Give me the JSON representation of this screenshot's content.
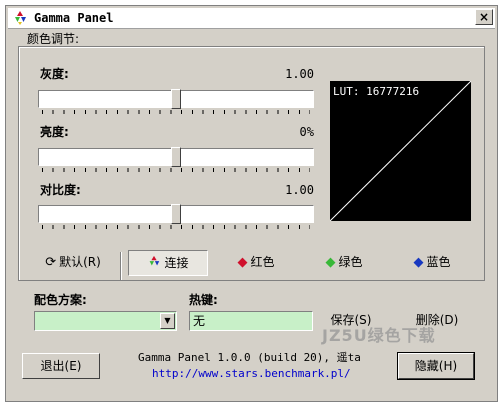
{
  "window": {
    "title": "Gamma Panel",
    "close_label": "×"
  },
  "color_adjust": {
    "group_label": "颜色调节:",
    "sliders": [
      {
        "label": "灰度:",
        "value": "1.00",
        "position": 0.5
      },
      {
        "label": "亮度:",
        "value": "0%",
        "position": 0.5
      },
      {
        "label": "对比度:",
        "value": "1.00",
        "position": 0.5
      }
    ],
    "lut_text": "LUT: 16777216"
  },
  "buttons": {
    "default_label": "默认(R)",
    "link_label": "连接",
    "red_label": "红色",
    "green_label": "绿色",
    "blue_label": "蓝色",
    "save_label": "保存(S)",
    "delete_label": "删除(D)",
    "exit_label": "退出(E)",
    "hide_label": "隐藏(H)"
  },
  "scheme": {
    "label": "配色方案:",
    "value": ""
  },
  "hotkey": {
    "label": "热键:",
    "value": "无"
  },
  "footer": {
    "version_text": "Gamma Panel 1.0.0 (build 20), 遥ta",
    "url": "http://www.stars.benchmark.pl/"
  },
  "watermark": "JZ5U绿色下载",
  "colors": {
    "red": "#d0102c",
    "green": "#38b838",
    "blue": "#1838c0",
    "field_bg": "#c8f0c8"
  }
}
